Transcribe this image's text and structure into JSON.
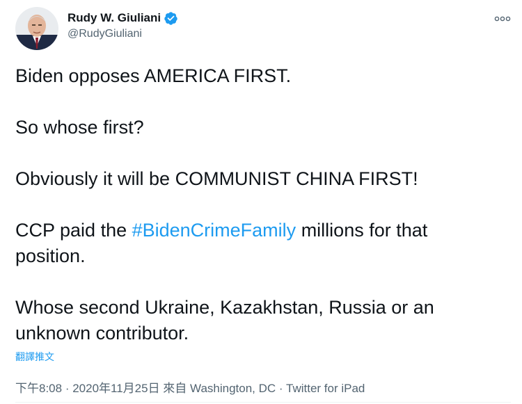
{
  "tweet": {
    "display_name": "Rudy W. Giuliani",
    "handle": "@RudyGiuliani",
    "verified": true,
    "verified_icon": "verified-badge-icon",
    "more_icon": "more-options-icon",
    "paragraphs": {
      "p1": "Biden opposes AMERICA FIRST.",
      "p2": "So whose first?",
      "p3": "Obviously it will be COMMUNIST CHINA FIRST!",
      "p4_before": "CCP paid the ",
      "p4_hashtag": "#BidenCrimeFamily",
      "p4_after": " millions for that position.",
      "p5": "Whose second Ukraine, Kazakhstan, Russia or an unknown contributor."
    },
    "translate_label": "翻譯推文",
    "time": "下午8:08",
    "separator": " · ",
    "date": "2020年11月25日",
    "from_label": " 來自 ",
    "location": "Washington, DC",
    "source": "Twitter for iPad"
  },
  "colors": {
    "link": "#1d9bf0",
    "text": "#0f1419",
    "muted": "#536471"
  }
}
